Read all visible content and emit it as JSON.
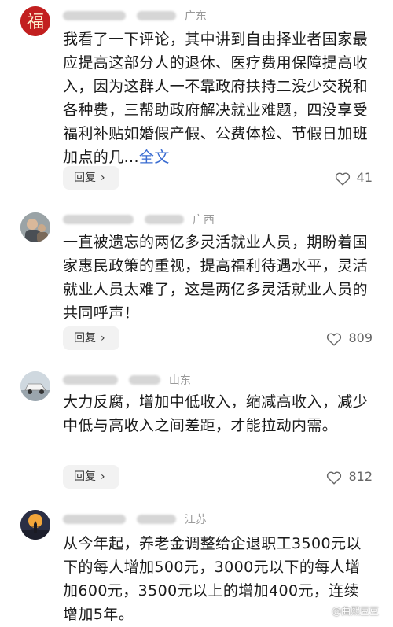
{
  "comments": [
    {
      "location": "广东",
      "text": "我看了一下评论，其中讲到自由择业者国家最应提高这部分人的退休、医疗费用保障提高收入，因为这群人一不靠政府扶持二没少交税和各种费，三帮助政府解决就业难题，四没享受福利补贴如婚假产假、公费体检、节假日加班加点的几...",
      "more_label": "全文",
      "reply_label": "回复",
      "likes": "41"
    },
    {
      "location": "广西",
      "text": "一直被遗忘的两亿多灵活就业人员，期盼着国家惠民政策的重视，提高福利待遇水平，灵活就业人员太难了，这是两亿多灵活就业人员的共同呼声！",
      "reply_label": "回复",
      "likes": "809"
    },
    {
      "location": "山东",
      "text": "大力反腐，增加中低收入，缩减高收入，减少中低与高收入之间差距，才能拉动内需。",
      "reply_label": "回复",
      "likes": "812"
    },
    {
      "location": "江苏",
      "text": "从今年起，养老金调整给企退职工3500元以下的每人增加500元，3000元以下的每人增加600元，3500元以上的增加400元，连续增加5年。"
    }
  ],
  "watermark": "@曲熙豆豆",
  "colors": {
    "link": "#3a6cd1",
    "meta": "#9a9a9a",
    "button_bg": "#f2f2f2"
  }
}
